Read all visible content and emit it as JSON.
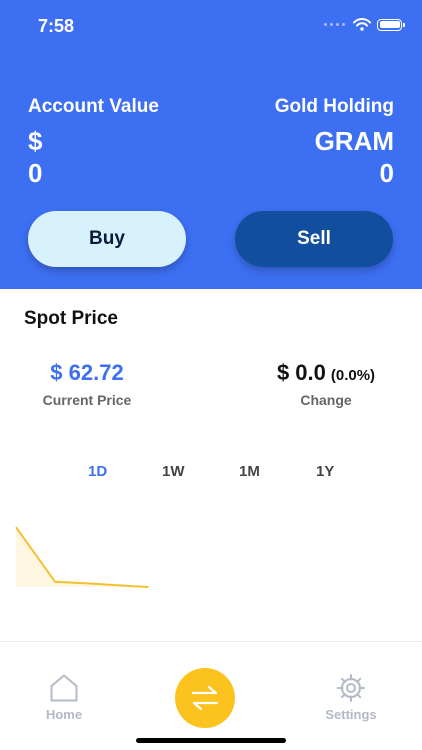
{
  "status_bar": {
    "time": "7:58"
  },
  "account": {
    "label": "Account Value",
    "currency": "$",
    "amount": "0"
  },
  "gold": {
    "label": "Gold Holding",
    "unit": "GRAM",
    "amount": "0"
  },
  "actions": {
    "buy_label": "Buy",
    "sell_label": "Sell"
  },
  "spot": {
    "title": "Spot Price",
    "current_price": "$ 62.72",
    "current_caption": "Current Price",
    "change_value": "$ 0.0",
    "change_pct": "(0.0%)",
    "change_caption": "Change"
  },
  "tabs": [
    {
      "label": "1D",
      "active": true
    },
    {
      "label": "1W",
      "active": false
    },
    {
      "label": "1M",
      "active": false
    },
    {
      "label": "1Y",
      "active": false
    }
  ],
  "chart_data": {
    "type": "area",
    "x": [
      0,
      1,
      2,
      3,
      3.4
    ],
    "values": [
      64.2,
      62.85,
      62.8,
      62.74,
      62.72
    ],
    "ylim": [
      62.72,
      64.6
    ],
    "xlim": [
      0,
      10
    ],
    "color": "#f5c030",
    "fill": "#fef6e0",
    "grid": false,
    "legend": "none"
  },
  "bottom_nav": {
    "home_label": "Home",
    "home_icon": "home-icon",
    "swap_icon": "swap-arrows-icon",
    "settings_label": "Settings",
    "settings_icon": "gear-icon"
  },
  "colors": {
    "primary": "#3d6ff2",
    "sell_button": "#124e9e",
    "buy_button": "#d7f1fd",
    "accent": "#fcc21d",
    "nav_inactive": "#b3b9c6"
  }
}
